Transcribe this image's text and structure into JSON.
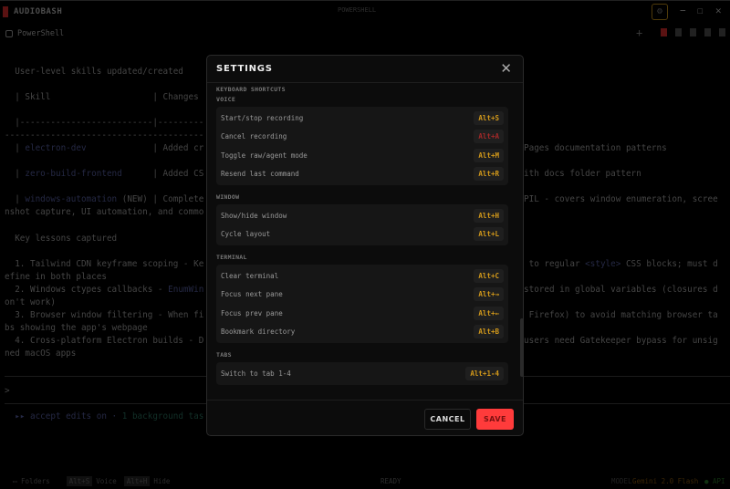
{
  "window": {
    "app_name": "AUDIOBASH",
    "title": "POWERSHELL",
    "tab": "PowerShell"
  },
  "terminal": {
    "lines": [
      {
        "left": "  User-level skills updated/created",
        "right": ""
      },
      {
        "left": "  | Skill                    | Changes",
        "right": ""
      },
      {
        "left": "  |--------------------------|---------",
        "right": ""
      },
      {
        "left": "---------------------------------------",
        "right": ""
      },
      {
        "left": "  | ",
        "link": "electron-dev",
        "after": "             | Added cr",
        "right": "Pages documentation patterns"
      },
      {
        "left": "  | ",
        "link": "zero-build-frontend",
        "after": "      | Added CS",
        "right": "ith docs folder pattern"
      },
      {
        "left": "  | ",
        "link": "windows-automation",
        "after": " (NEW) | Complete",
        "right": "PIL - covers window enumeration, scree"
      },
      {
        "left": "nshot capture, UI automation, and commo",
        "right": ""
      },
      {
        "left": "  Key lessons captured",
        "right": ""
      },
      {
        "left": "  1. Tailwind CDN keyframe scoping - Ke",
        "right": " to regular ",
        "rlink": "<style>",
        "rafter": " CSS blocks; must d"
      },
      {
        "left": "efine in both places",
        "right": ""
      },
      {
        "left": "  2. Windows ctypes callbacks - ",
        "link": "EnumWin",
        "after": "",
        "right": "stored in global variables (closures d"
      },
      {
        "left": "on't work)",
        "right": ""
      },
      {
        "left": "  3. Browser window filtering - When fi",
        "right": " Firefox) to avoid matching browser ta"
      },
      {
        "left": "bs showing the app's webpage",
        "right": ""
      },
      {
        "left": "  4. Cross-platform Electron builds - D",
        "right": "users need Gatekeeper bypass for unsig"
      },
      {
        "left": "ned macOS apps",
        "right": ""
      }
    ],
    "prompt": ">",
    "hint_prefix": "  ▸▸ accept edits on · ",
    "hint_green": "1 background tas"
  },
  "status": {
    "folders": "Folders",
    "k1": "Alt+S",
    "l1": "Voice",
    "k2": "Alt+H",
    "l2": "Hide",
    "state": "READY",
    "model_label": "MODEL",
    "model": "Gemini 2.0 Flash",
    "api": "● API"
  },
  "settings": {
    "title": "SETTINGS",
    "heading": "KEYBOARD SHORTCUTS",
    "groups": [
      {
        "name": "VOICE",
        "items": [
          [
            "Start/stop recording",
            "Alt+S"
          ],
          [
            "Cancel recording",
            "Alt+A"
          ],
          [
            "Toggle raw/agent mode",
            "Alt+M"
          ],
          [
            "Resend last command",
            "Alt+R"
          ]
        ]
      },
      {
        "name": "WINDOW",
        "items": [
          [
            "Show/hide window",
            "Alt+H"
          ],
          [
            "Cycle layout",
            "Alt+L"
          ]
        ]
      },
      {
        "name": "TERMINAL",
        "items": [
          [
            "Clear terminal",
            "Alt+C"
          ],
          [
            "Focus next pane",
            "Alt+→"
          ],
          [
            "Focus prev pane",
            "Alt+←"
          ],
          [
            "Bookmark directory",
            "Alt+B"
          ]
        ]
      },
      {
        "name": "TABS",
        "items": [
          [
            "Switch to tab 1-4",
            "Alt+1-4"
          ]
        ]
      }
    ],
    "cancel": "CANCEL",
    "save": "SAVE"
  },
  "colors": {
    "accent": "#d49a1a",
    "danger": "#ff3b3b"
  }
}
